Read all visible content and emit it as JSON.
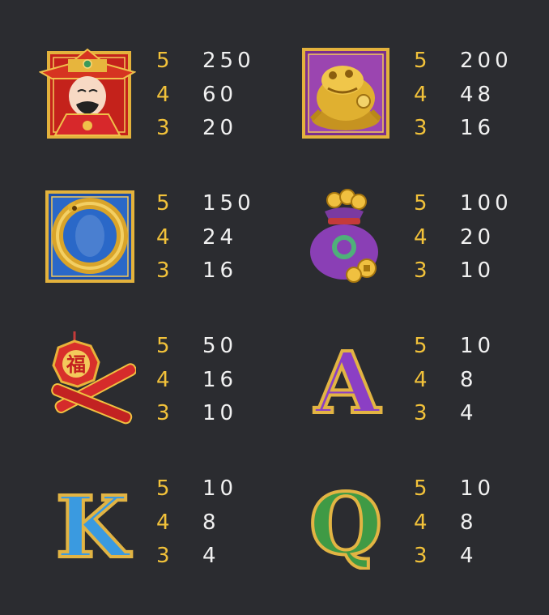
{
  "symbols": [
    {
      "id": "wealth-god",
      "icon": "god-of-wealth-icon",
      "payouts": [
        {
          "count": "5",
          "value": "250"
        },
        {
          "count": "4",
          "value": "60"
        },
        {
          "count": "3",
          "value": "20"
        }
      ]
    },
    {
      "id": "toad",
      "icon": "golden-toad-icon",
      "payouts": [
        {
          "count": "5",
          "value": "200"
        },
        {
          "count": "4",
          "value": "48"
        },
        {
          "count": "3",
          "value": "16"
        }
      ]
    },
    {
      "id": "koi",
      "icon": "golden-koi-icon",
      "payouts": [
        {
          "count": "5",
          "value": "150"
        },
        {
          "count": "4",
          "value": "24"
        },
        {
          "count": "3",
          "value": "16"
        }
      ]
    },
    {
      "id": "money-bag",
      "icon": "money-bag-icon",
      "payouts": [
        {
          "count": "5",
          "value": "100"
        },
        {
          "count": "4",
          "value": "20"
        },
        {
          "count": "3",
          "value": "10"
        }
      ]
    },
    {
      "id": "firecracker",
      "icon": "firecracker-icon",
      "icon_text": "福",
      "payouts": [
        {
          "count": "5",
          "value": "50"
        },
        {
          "count": "4",
          "value": "16"
        },
        {
          "count": "3",
          "value": "10"
        }
      ]
    },
    {
      "id": "letter-a",
      "icon": "letter-a-icon",
      "icon_text": "A",
      "payouts": [
        {
          "count": "5",
          "value": "10"
        },
        {
          "count": "4",
          "value": "8"
        },
        {
          "count": "3",
          "value": "4"
        }
      ]
    },
    {
      "id": "letter-k",
      "icon": "letter-k-icon",
      "icon_text": "K",
      "payouts": [
        {
          "count": "5",
          "value": "10"
        },
        {
          "count": "4",
          "value": "8"
        },
        {
          "count": "3",
          "value": "4"
        }
      ]
    },
    {
      "id": "letter-q",
      "icon": "letter-q-icon",
      "icon_text": "Q",
      "payouts": [
        {
          "count": "5",
          "value": "10"
        },
        {
          "count": "4",
          "value": "8"
        },
        {
          "count": "3",
          "value": "4"
        }
      ]
    }
  ],
  "colors": {
    "background": "#2b2c30",
    "count": "#f2c23a",
    "value": "#f1f1f1"
  }
}
